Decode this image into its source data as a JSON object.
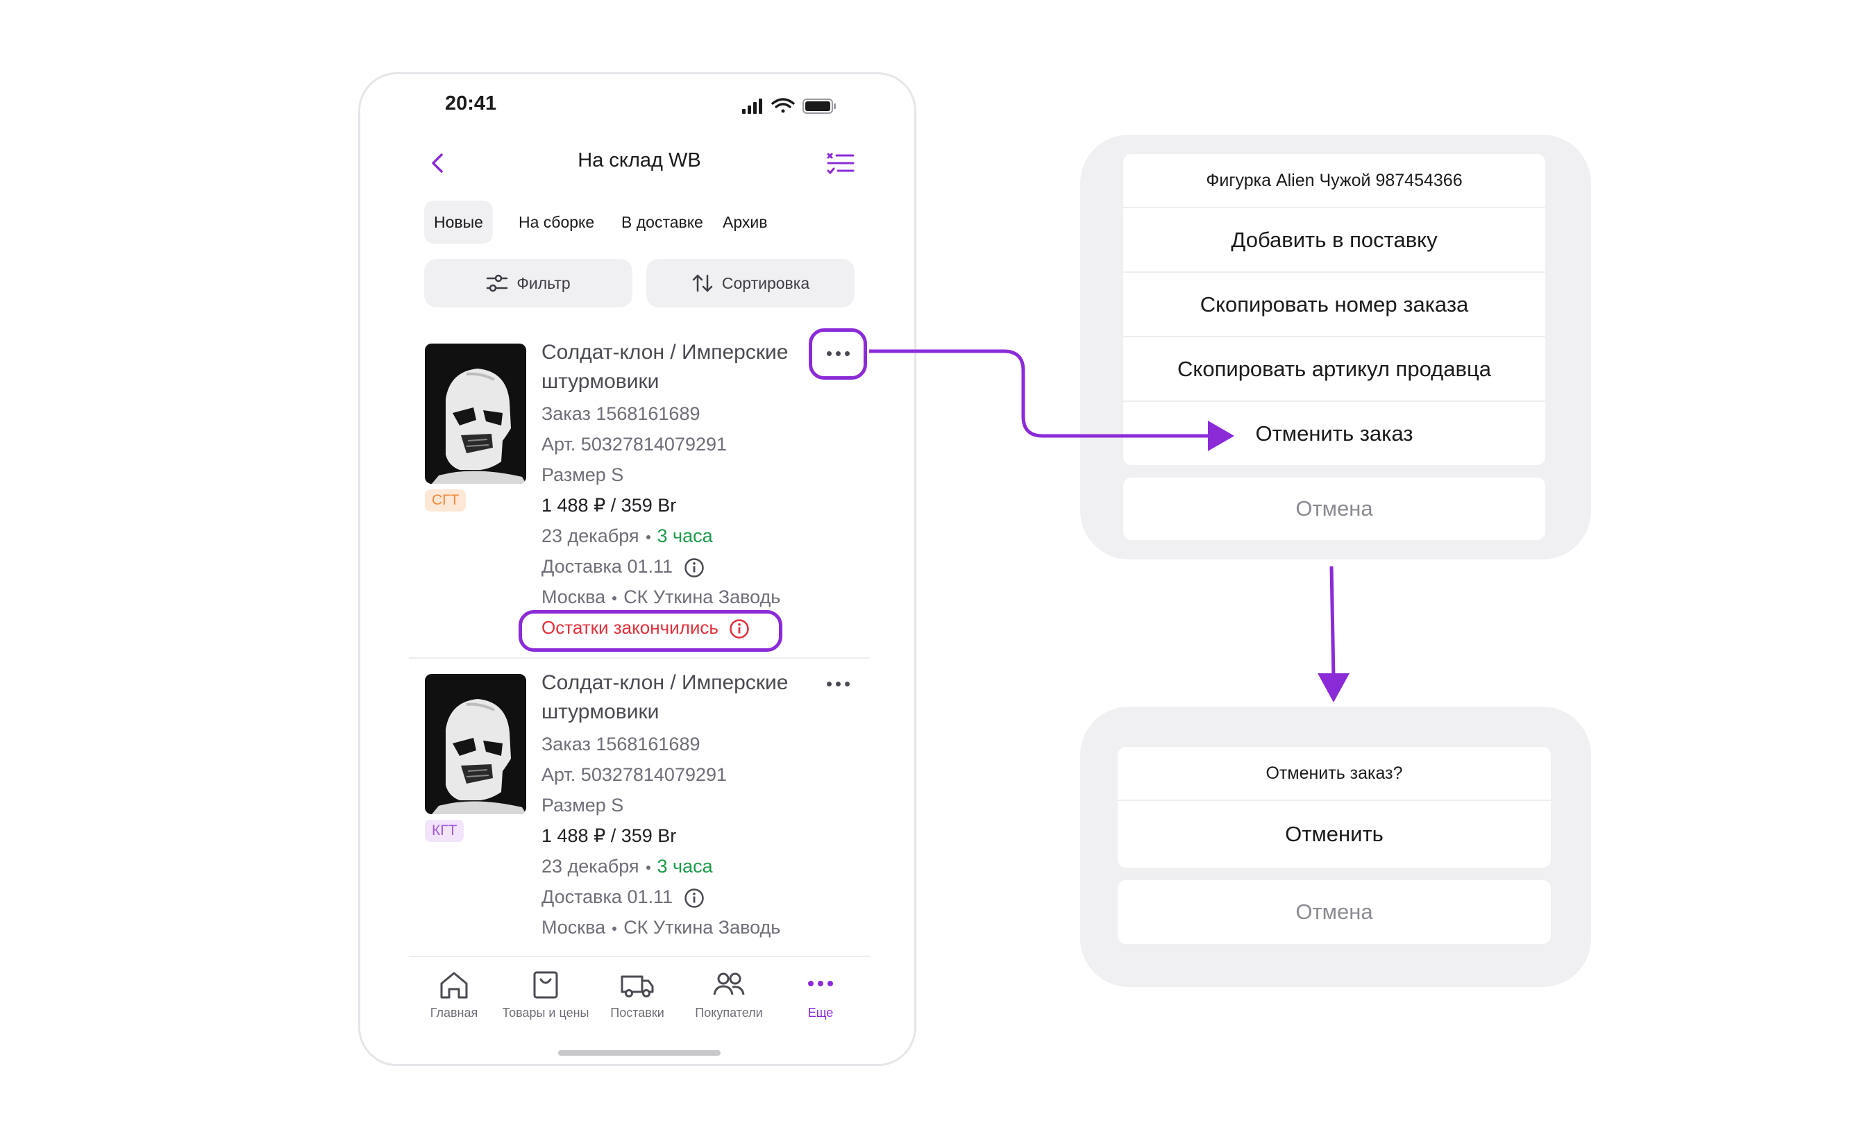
{
  "status": {
    "time": "20:41"
  },
  "nav": {
    "title": "На склад WB"
  },
  "tabs": [
    {
      "label": "Новые",
      "active": true
    },
    {
      "label": "На сборке",
      "active": false
    },
    {
      "label": "В доставке",
      "active": false
    },
    {
      "label": "Архив",
      "active": false
    }
  ],
  "filters": {
    "filter_label": "Фильтр",
    "sort_label": "Сортировка"
  },
  "orders": [
    {
      "title_line1": "Солдат-клон / Имперские",
      "title_line2": "штурмовики",
      "order": "Заказ 1568161689",
      "article": "Арт. 50327814079291",
      "size": "Размер S",
      "price": "1 488 ₽ / 359 Br",
      "date": "23 декабря",
      "time_left": "3 часа",
      "delivery": "Доставка 01.11",
      "city": "Москва",
      "warehouse": "СК Уткина Заводь",
      "badge": "СГТ",
      "warning": "Остатки закончились"
    },
    {
      "title_line1": "Солдат-клон / Имперские",
      "title_line2": "штурмовики",
      "order": "Заказ 1568161689",
      "article": "Арт. 50327814079291",
      "size": "Размер S",
      "price": "1 488 ₽ / 359 Br",
      "date": "23 декабря",
      "time_left": "3 часа",
      "delivery": "Доставка 01.11",
      "city": "Москва",
      "warehouse": "СК Уткина Заводь",
      "badge": "КГТ"
    }
  ],
  "tabbar": [
    {
      "label": "Главная",
      "icon": "home-icon"
    },
    {
      "label": "Товары и цены",
      "icon": "bag-icon"
    },
    {
      "label": "Поставки",
      "icon": "truck-icon"
    },
    {
      "label": "Покупатели",
      "icon": "users-icon"
    },
    {
      "label": "Еще",
      "icon": "more-icon",
      "active": true
    }
  ],
  "action_sheet": {
    "title": "Фигурка Alien Чужой 987454366",
    "add_to_supply": "Добавить в поставку",
    "copy_order_number": "Скопировать номер заказа",
    "copy_seller_article": "Скопировать артикул продавца",
    "cancel_order": "Отменить заказ",
    "dismiss": "Отмена"
  },
  "confirm_sheet": {
    "title": "Отменить заказ?",
    "confirm": "Отменить",
    "dismiss": "Отмена"
  },
  "colors": {
    "accent": "#8b2bd8",
    "green": "#1c9a4a",
    "red": "#e0303a",
    "badge_orange_bg": "#fde8d7",
    "badge_orange_text": "#f08a3c",
    "badge_purple_bg": "#f1e4fb",
    "badge_purple_text": "#a35ad8"
  }
}
